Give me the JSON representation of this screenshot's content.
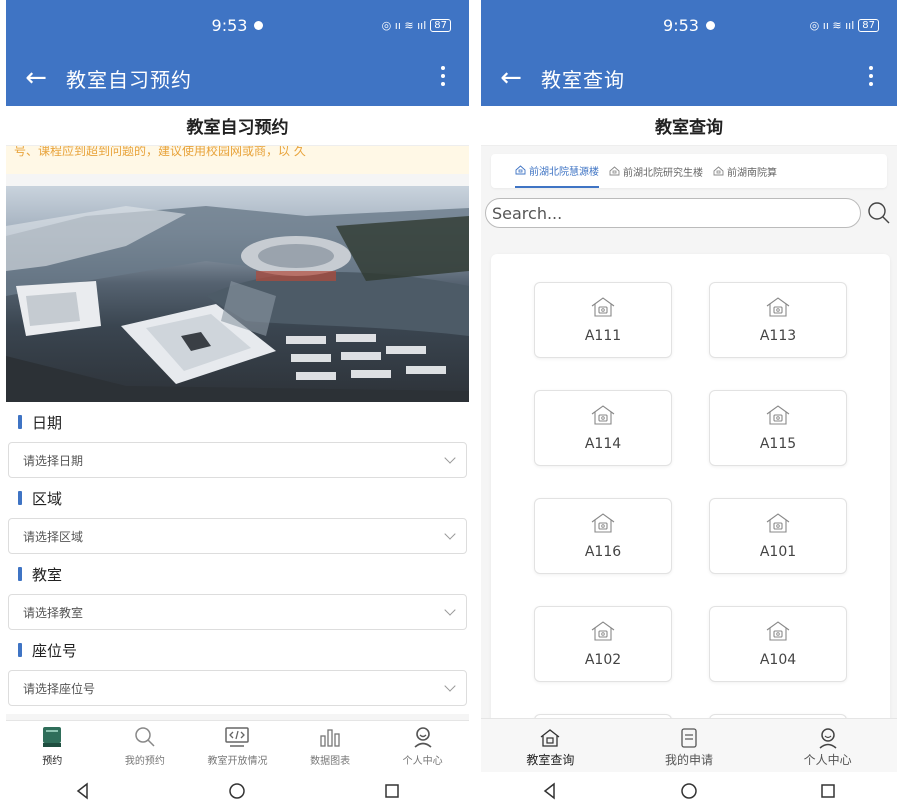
{
  "left": {
    "status": {
      "time": "9:53",
      "battery": "87"
    },
    "appbar": {
      "back_icon": "arrow-left-icon",
      "title": "教室自习预约",
      "menu_icon": "more-vertical-icon"
    },
    "page_title": "教室自习预约",
    "notice": "号、课程应到超到问题的，建议使用校园网或商，以 久",
    "banner": {
      "image": "aerial-campus-photo"
    },
    "form": {
      "date": {
        "label": "日期",
        "placeholder": "请选择日期"
      },
      "area": {
        "label": "区域",
        "placeholder": "请选择区域"
      },
      "classroom": {
        "label": "教室",
        "placeholder": "请选择教室"
      },
      "seat": {
        "label": "座位号",
        "placeholder": "请选择座位号"
      }
    },
    "tabs": [
      {
        "label": "预约",
        "icon": "book-icon"
      },
      {
        "label": "我的预约",
        "icon": "search-icon"
      },
      {
        "label": "教室开放情况",
        "icon": "code-icon"
      },
      {
        "label": "数据图表",
        "icon": "bar-chart-icon"
      },
      {
        "label": "个人中心",
        "icon": "user-icon"
      }
    ]
  },
  "right": {
    "status": {
      "time": "9:53",
      "battery": "87"
    },
    "appbar": {
      "back_icon": "arrow-left-icon",
      "title": "教室查询",
      "menu_icon": "more-vertical-icon"
    },
    "page_title": "教室查询",
    "buildings": [
      "前湖北院慧源楼",
      "前湖北院研究生楼",
      "前湖南院算"
    ],
    "search": {
      "placeholder": "Search..."
    },
    "rooms": [
      "A111",
      "A113",
      "A114",
      "A115",
      "A116",
      "A101",
      "A102",
      "A104"
    ],
    "tabs": [
      {
        "label": "教室查询",
        "icon": "home-icon"
      },
      {
        "label": "我的申请",
        "icon": "document-icon"
      },
      {
        "label": "个人中心",
        "icon": "user-icon"
      }
    ]
  },
  "colors": {
    "primary": "#3f74c4",
    "notice_text": "#e8a33b"
  }
}
